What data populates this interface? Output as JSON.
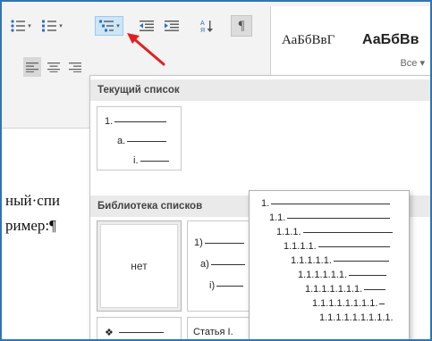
{
  "ribbon": {
    "style_samples": [
      "АаБбВвГ",
      "АаБбВв"
    ],
    "styles_more": "Все ▾"
  },
  "document": {
    "line1": "ный·спи",
    "line2": "ример:¶"
  },
  "panel": {
    "current_header": "Текущий список",
    "current_list": [
      "1.",
      "a.",
      "i."
    ],
    "library_header": "Библиотека списков",
    "none_label": "нет",
    "library_list": [
      "1)",
      "a)",
      "i)"
    ],
    "bullet_item": "❖",
    "article_item": "Статья I."
  },
  "popup": {
    "levels": [
      "1.",
      "1.1.",
      "1.1.1.",
      "1.1.1.1.",
      "1.1.1.1.1.",
      "1.1.1.1.1.1.",
      "1.1.1.1.1.1.1.",
      "1.1.1.1.1.1.1.1.",
      "1.1.1.1.1.1.1.1.1."
    ]
  },
  "colors": {
    "frame_border": "#2e75b6",
    "annotation_arrow": "#e02020",
    "highlight": "#cde6f7"
  }
}
